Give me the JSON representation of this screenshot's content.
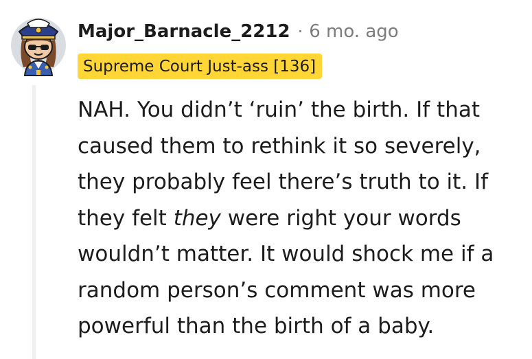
{
  "comment": {
    "username": "Major_Barnacle_2212",
    "separator": "·",
    "timestamp": "6 mo. ago",
    "flair": "Supreme Court Just-ass [136]",
    "body": {
      "before_emphasis": "NAH. You didn’t ‘ruin’ the birth. If that caused them to rethink it so severely, they probably feel there’s truth to it. If they felt ",
      "emphasis": "they",
      "after_emphasis": " were right your words wouldn’t matter. It would shock me if a random person’s comment was more powerful than the birth of a baby."
    }
  },
  "colors": {
    "flair_background": "#ffd635",
    "username": "#1c1c1c",
    "meta_text": "#7c7c7c",
    "thread_line": "#edeff1"
  },
  "icons": {
    "avatar": "snoo-avatar-captain-hat-sunglasses"
  }
}
